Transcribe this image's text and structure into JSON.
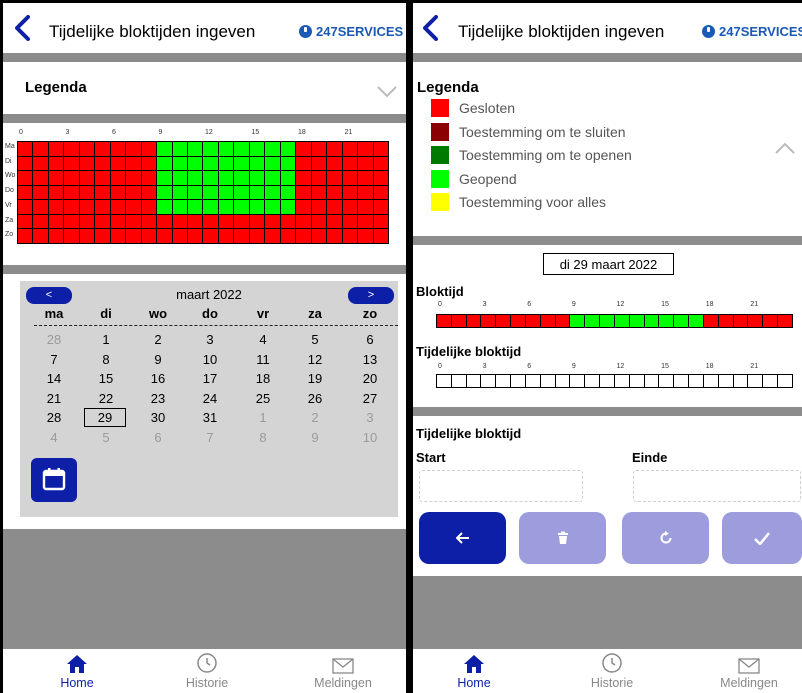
{
  "header": {
    "title": "Tijdelijke bloktijden ingeven",
    "logo_text": "247SERVICES"
  },
  "colors": {
    "accent": "#0d1fa6",
    "accent_light": "#9d9ddd",
    "gap": "#8c8c8c",
    "red": "#ff0000",
    "dark_red": "#8b0000",
    "green_dark": "#007a00",
    "green": "#00ff00",
    "yellow": "#ffff00"
  },
  "left": {
    "legend_title": "Legenda",
    "hours": [
      "0",
      "3",
      "6",
      "9",
      "12",
      "15",
      "18",
      "21"
    ],
    "days": [
      "Ma",
      "Di",
      "Wo",
      "Do",
      "Vr",
      "Za",
      "Zo"
    ],
    "calendar": {
      "prev": "<",
      "next": ">",
      "month": "maart 2022",
      "weekdays": [
        "ma",
        "di",
        "wo",
        "do",
        "vr",
        "za",
        "zo"
      ],
      "weeks": [
        [
          "28",
          "1",
          "2",
          "3",
          "4",
          "5",
          "6"
        ],
        [
          "7",
          "8",
          "9",
          "10",
          "11",
          "12",
          "13"
        ],
        [
          "14",
          "15",
          "16",
          "17",
          "18",
          "19",
          "20"
        ],
        [
          "21",
          "22",
          "23",
          "24",
          "25",
          "26",
          "27"
        ],
        [
          "28",
          "29",
          "30",
          "31",
          "1",
          "2",
          "3"
        ],
        [
          "4",
          "5",
          "6",
          "7",
          "8",
          "9",
          "10"
        ]
      ],
      "selected": "29"
    }
  },
  "right": {
    "legend_title": "Legenda",
    "legend_items": [
      {
        "label": "Gesloten",
        "color": "#ff0000"
      },
      {
        "label": "Toestemming om te sluiten",
        "color": "#8b0000"
      },
      {
        "label": "Toestemming om te openen",
        "color": "#007a00"
      },
      {
        "label": "Geopend",
        "color": "#00ff00"
      },
      {
        "label": "Toestemming voor alles",
        "color": "#ffff00"
      }
    ],
    "date": "di 29 maart 2022",
    "bloktijd_label": "Bloktijd",
    "tijdelijke_label": "Tijdelijke bloktijd",
    "hours": [
      "0",
      "3",
      "6",
      "9",
      "12",
      "15",
      "18",
      "21"
    ],
    "form_title": "Tijdelijke bloktijd",
    "start_label": "Start",
    "einde_label": "Einde",
    "start_value": "",
    "einde_value": "",
    "buttons": [
      "back-arrow-icon",
      "trash-icon",
      "refresh-icon",
      "check-icon"
    ]
  },
  "nav": {
    "home": "Home",
    "history": "Historie",
    "notifications": "Meldingen"
  }
}
